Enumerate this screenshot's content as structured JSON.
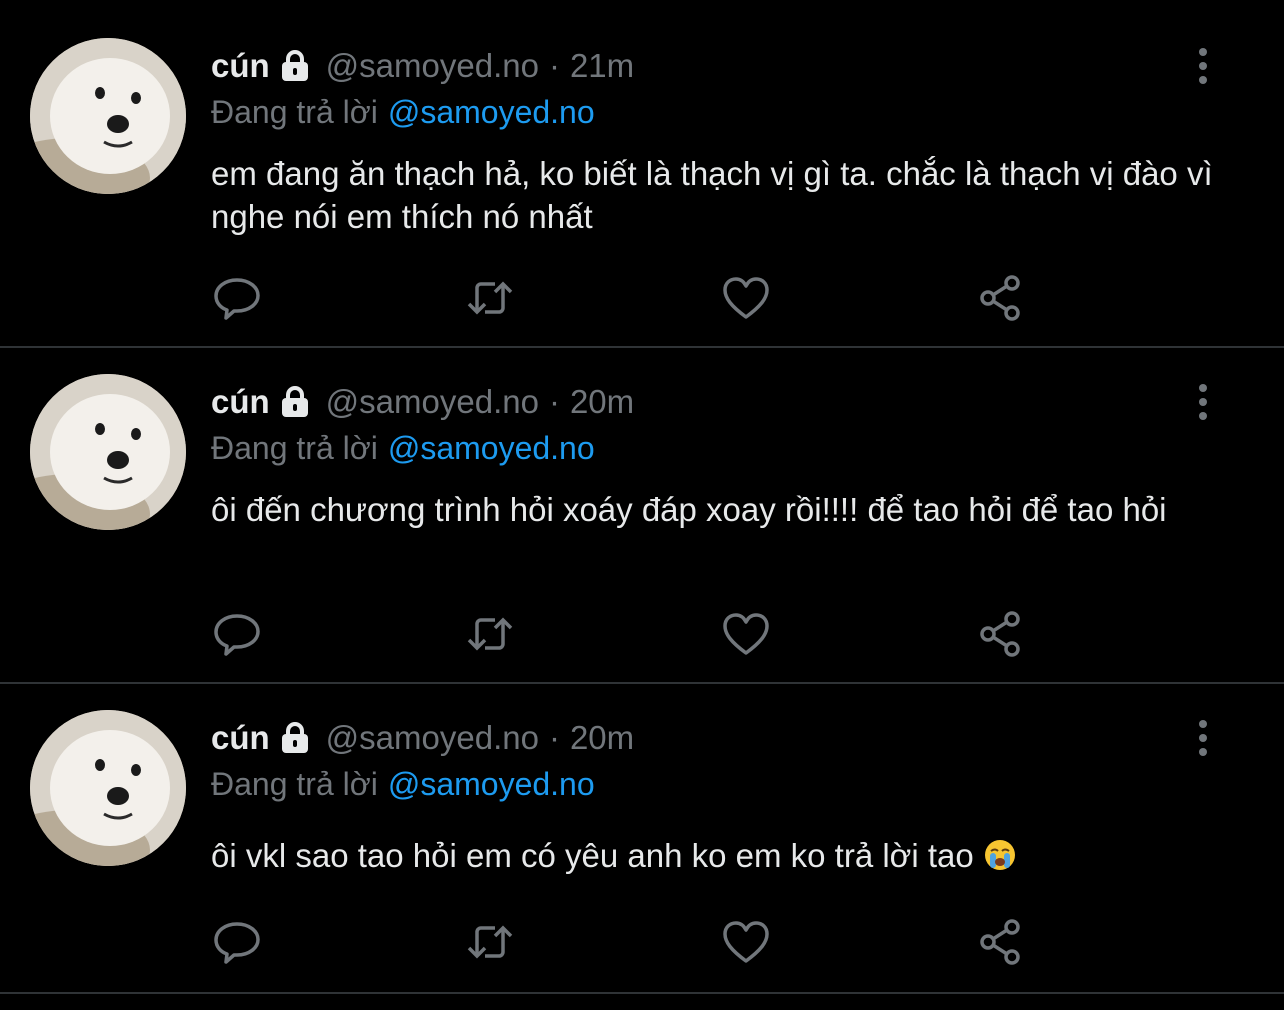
{
  "colors": {
    "background": "#000000",
    "text_primary": "#e7e9ea",
    "text_secondary": "#71767b",
    "mention": "#1d9bf0",
    "divider": "#2f3336"
  },
  "tweets": [
    {
      "name": "cún",
      "handle": "@samoyed.no",
      "separator": "·",
      "time": "21m",
      "reply_prefix": "Đang trả lời",
      "reply_mention": "@samoyed.no",
      "text": "em đang ăn thạch hả, ko biết là thạch vị gì ta. chắc là thạch vị đào vì nghe nói em thích nó nhất"
    },
    {
      "name": "cún",
      "handle": "@samoyed.no",
      "separator": "·",
      "time": "20m",
      "reply_prefix": "Đang trả lời",
      "reply_mention": "@samoyed.no",
      "text": "ôi đến chương trình hỏi xoáy đáp xoay rồi!!!! để tao hỏi để tao hỏi"
    },
    {
      "name": "cún",
      "handle": "@samoyed.no",
      "separator": "·",
      "time": "20m",
      "reply_prefix": "Đang trả lời",
      "reply_mention": "@samoyed.no",
      "text": "ôi vkl sao tao hỏi em có yêu anh ko em ko trả lời tao",
      "emoji": "loudly-crying-face-icon"
    }
  ],
  "icons": {
    "lock": "lock-icon",
    "more": "more-vertical-icon",
    "reply": "reply-icon",
    "retweet": "retweet-icon",
    "like": "heart-icon",
    "share": "share-icon"
  }
}
